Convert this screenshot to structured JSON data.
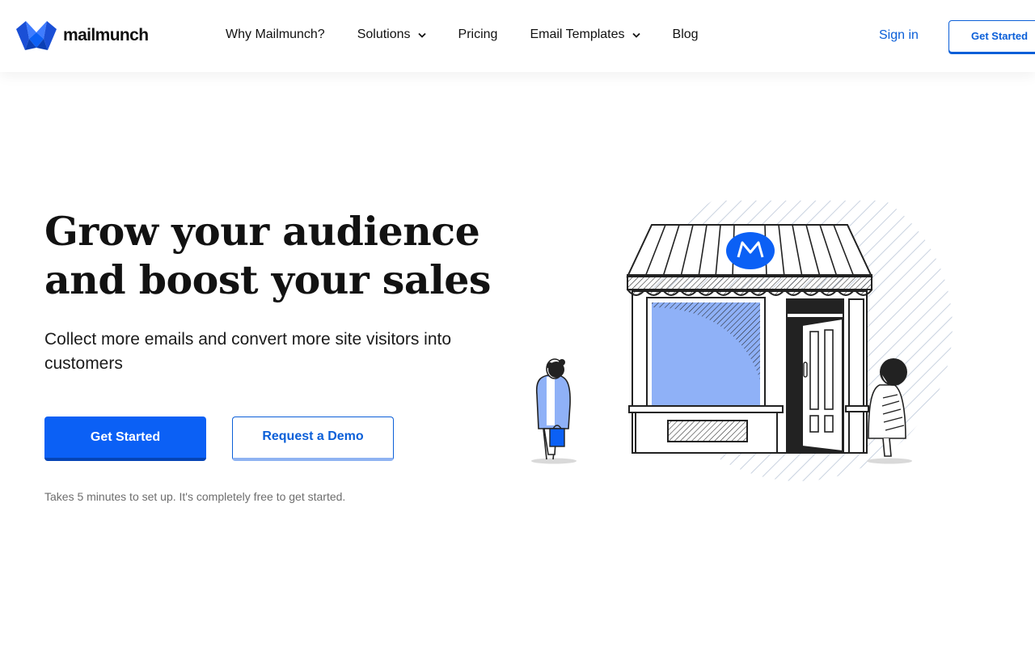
{
  "brand": {
    "name": "mailmunch",
    "accent": "#0b60f5",
    "link_color": "#0b5fd8",
    "illustration_blue": "#8fb1f7"
  },
  "nav": {
    "items": [
      {
        "label": "Why Mailmunch?",
        "has_dropdown": false
      },
      {
        "label": "Solutions",
        "has_dropdown": true
      },
      {
        "label": "Pricing",
        "has_dropdown": false
      },
      {
        "label": "Email Templates",
        "has_dropdown": true
      },
      {
        "label": "Blog",
        "has_dropdown": false
      }
    ],
    "sign_in": "Sign in",
    "get_started": "Get Started"
  },
  "hero": {
    "headline_line1": "Grow your audience",
    "headline_line2": "and boost your sales",
    "subhead": "Collect more emails and convert more site visitors into customers",
    "primary_cta": "Get Started",
    "secondary_cta": "Request a Demo",
    "note": "Takes 5 minutes to set up. It's completely free to get started."
  },
  "icons": [
    "mailmunch-logo-icon",
    "chevron-down-icon",
    "storefront-illustration"
  ]
}
